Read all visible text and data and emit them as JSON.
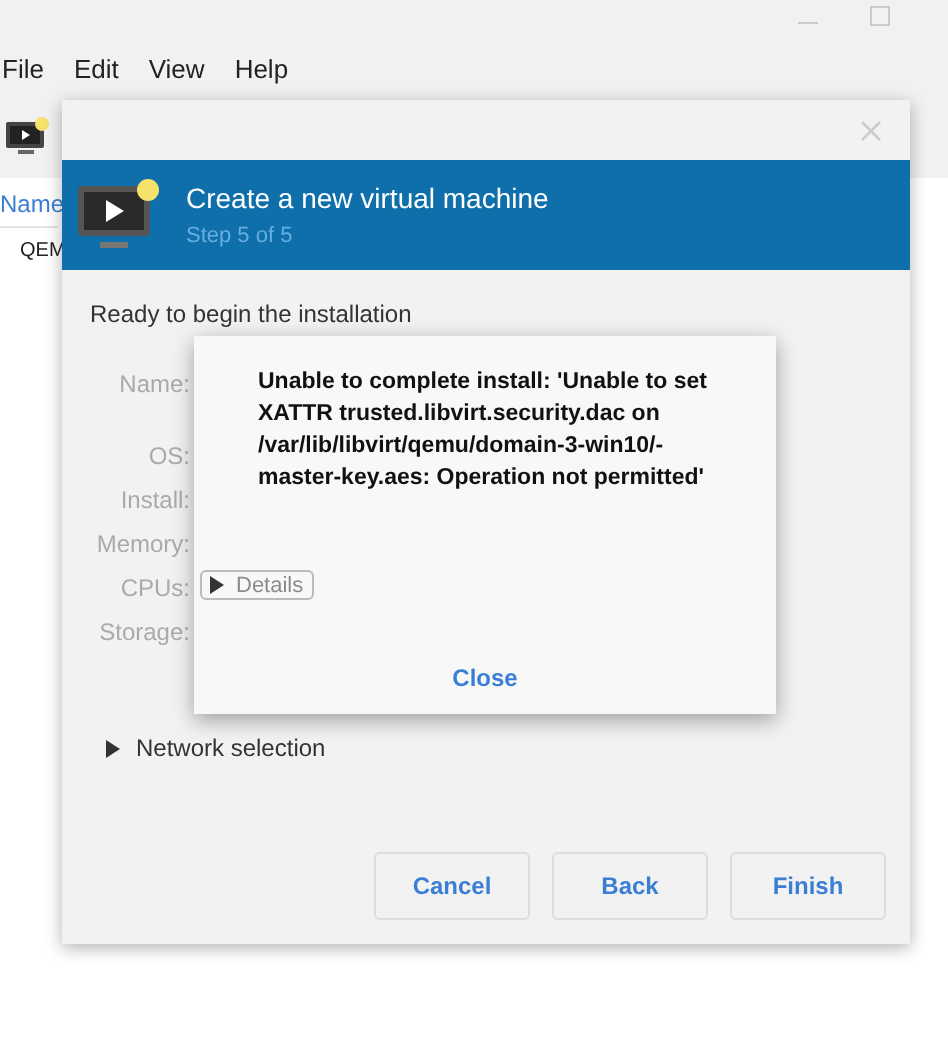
{
  "main_window": {
    "menu": [
      "File",
      "Edit",
      "View",
      "Help"
    ],
    "list_header": "Name",
    "rows": [
      "QEM"
    ]
  },
  "wizard": {
    "title": "Create a new virtual machine",
    "step": "Step 5 of 5",
    "heading": "Ready to begin the installation",
    "fields": [
      {
        "label": "Name:"
      },
      {
        "label": "OS:"
      },
      {
        "label": "Install:"
      },
      {
        "label": "Memory:"
      },
      {
        "label": "CPUs:"
      },
      {
        "label": "Storage:"
      }
    ],
    "network_expander": {
      "label": "Network selection",
      "expanded": false
    },
    "buttons": [
      "Cancel",
      "Back",
      "Finish"
    ]
  },
  "error_dialog": {
    "message": "Unable to complete install: 'Unable to set XATTR trusted.libvirt.security.dac on /var/lib/libvirt/qemu/domain-3-win10/-master-key.aes: Operation not permitted'",
    "details": {
      "label": "Details",
      "expanded": false,
      "disabled": true
    },
    "button": "Close"
  }
}
